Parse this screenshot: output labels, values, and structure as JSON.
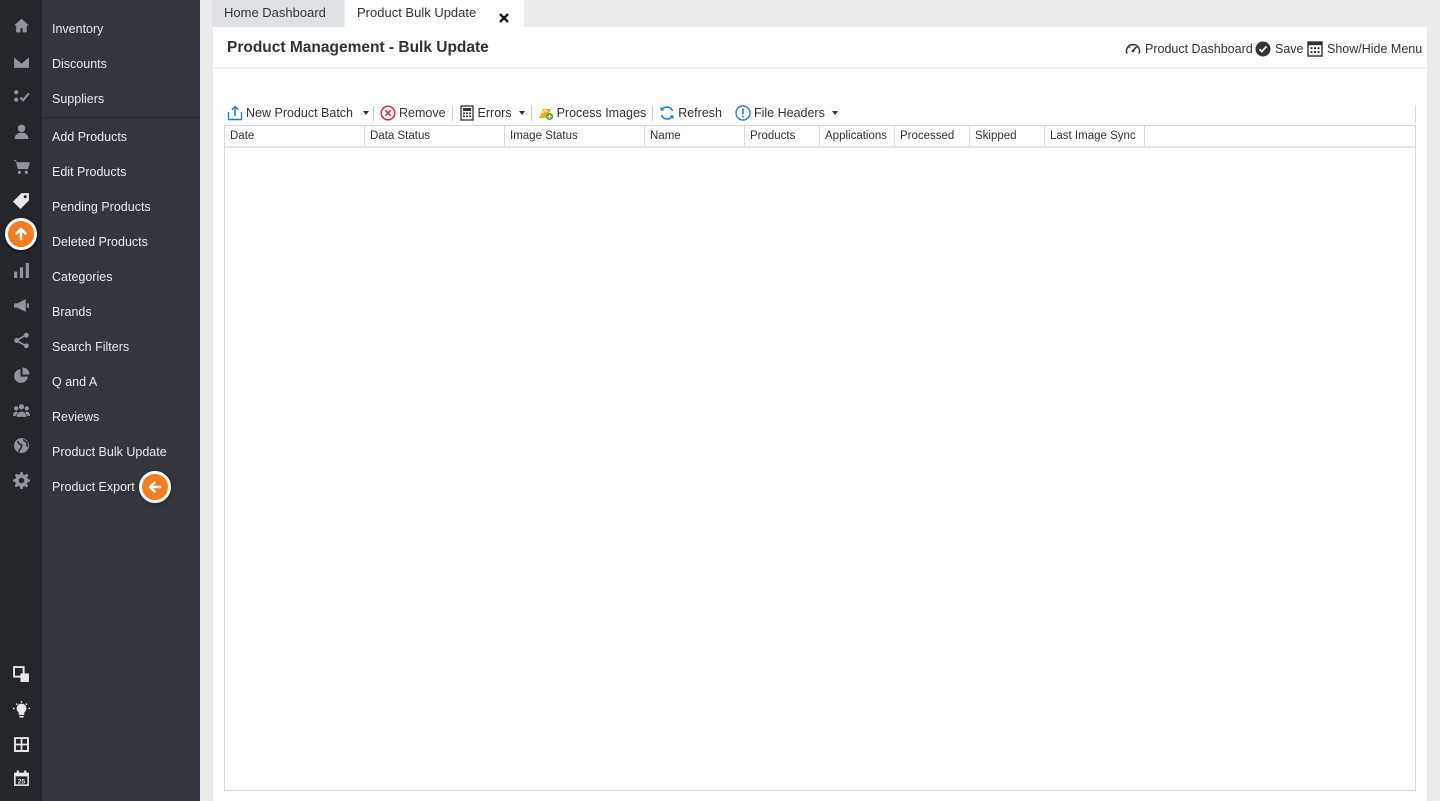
{
  "rail": {
    "icons": [
      "home-icon",
      "mail-icon",
      "checklist-icon",
      "user-icon",
      "cart-icon",
      "tag-icon",
      "upload-icon",
      "bar-chart-icon",
      "megaphone-icon",
      "share-icon",
      "pie-chart-icon",
      "users-icon",
      "globe-icon",
      "settings-icon",
      "layers-icon",
      "lightbulb-icon",
      "dashboard-grid-icon",
      "calendar-icon"
    ],
    "calendar_day": "25"
  },
  "menu": {
    "items": [
      {
        "label": "Inventory"
      },
      {
        "label": "Discounts"
      },
      {
        "label": "Suppliers"
      },
      {
        "label": "Add Products"
      },
      {
        "label": "Edit Products"
      },
      {
        "label": "Pending Products"
      },
      {
        "label": "Deleted Products"
      },
      {
        "label": "Categories"
      },
      {
        "label": "Brands"
      },
      {
        "label": "Search Filters"
      },
      {
        "label": "Q and A"
      },
      {
        "label": "Reviews"
      },
      {
        "label": "Product Bulk Update"
      },
      {
        "label": "Product Export"
      }
    ]
  },
  "tabs": [
    {
      "label": "Home Dashboard",
      "active": false
    },
    {
      "label": "Product Bulk Update",
      "active": true
    }
  ],
  "header": {
    "title": "Product Management - Bulk Update",
    "actions": {
      "dashboard": "Product Dashboard",
      "save": "Save",
      "menu_toggle": "Show/Hide Menu"
    }
  },
  "toolbar": {
    "new_batch": "New Product Batch",
    "remove": "Remove",
    "errors": "Errors",
    "process_images": "Process Images",
    "refresh": "Refresh",
    "file_headers": "File Headers"
  },
  "grid": {
    "columns": [
      "Date",
      "Data Status",
      "Image Status",
      "Name",
      "Products",
      "Applications",
      "Processed",
      "Skipped",
      "Last Image Sync"
    ],
    "rows": []
  },
  "colors": {
    "accent": "#f47b20",
    "rail_bg": "#23262b",
    "menu_bg": "#33373d",
    "remove_red": "#d9322f",
    "icon_blue": "#2a7fc4"
  }
}
